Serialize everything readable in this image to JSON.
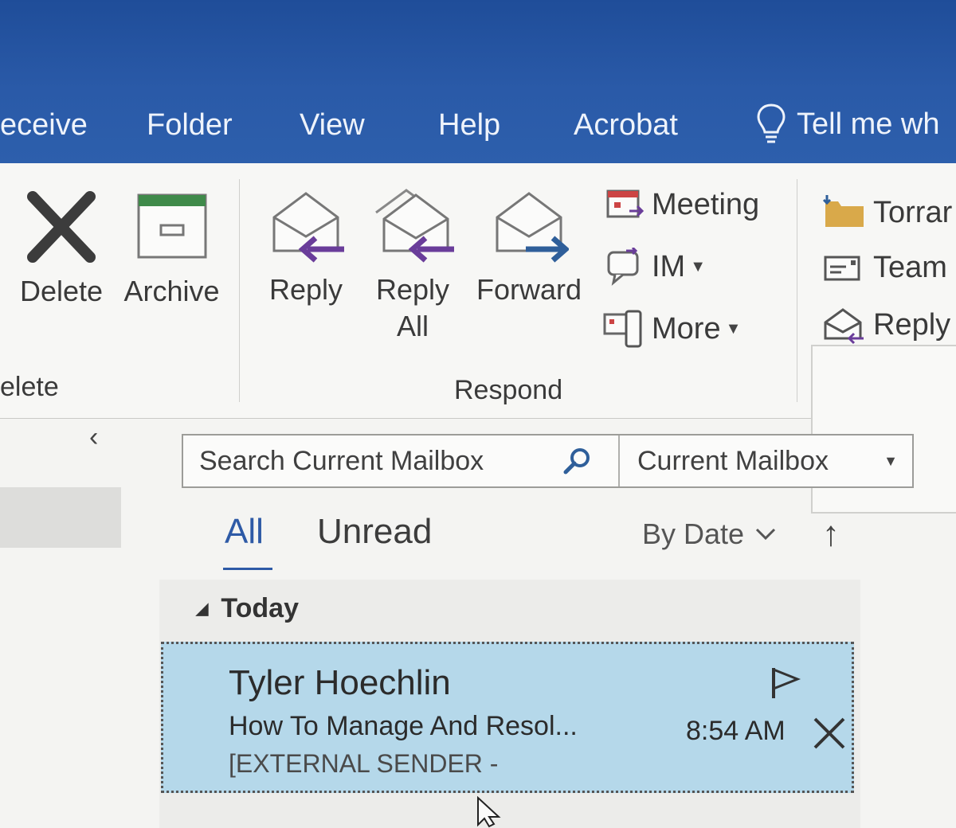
{
  "menu": {
    "tabs": [
      "eceive",
      "Folder",
      "View",
      "Help",
      "Acrobat"
    ],
    "tell_me": "Tell me wh"
  },
  "ribbon": {
    "delete_group": {
      "delete_label": "Delete",
      "archive_label": "Archive",
      "group_label": "elete"
    },
    "respond_group": {
      "reply_label": "Reply",
      "reply_all_label_1": "Reply",
      "reply_all_label_2": "All",
      "forward_label": "Forward",
      "meeting_label": "Meeting",
      "im_label": "IM",
      "more_label": "More",
      "group_label": "Respond"
    },
    "quick_steps": {
      "item1": "Torrar",
      "item2": "Team",
      "item3": "Reply"
    }
  },
  "search": {
    "placeholder": "Search Current Mailbox",
    "scope": "Current Mailbox"
  },
  "filters": {
    "all": "All",
    "unread": "Unread",
    "sort": "By Date"
  },
  "list": {
    "group": "Today",
    "messages": [
      {
        "sender": "Tyler Hoechlin",
        "subject": "How To Manage And Resol...",
        "preview": "[EXTERNAL SENDER -",
        "time": "8:54 AM"
      }
    ]
  },
  "colors": {
    "title_bar": "#2a5aa8",
    "accent": "#2e5aa6",
    "selected_row": "#b5d8ea",
    "reply_arrow": "#6a3d9a",
    "forward_arrow": "#2f5f9a"
  }
}
